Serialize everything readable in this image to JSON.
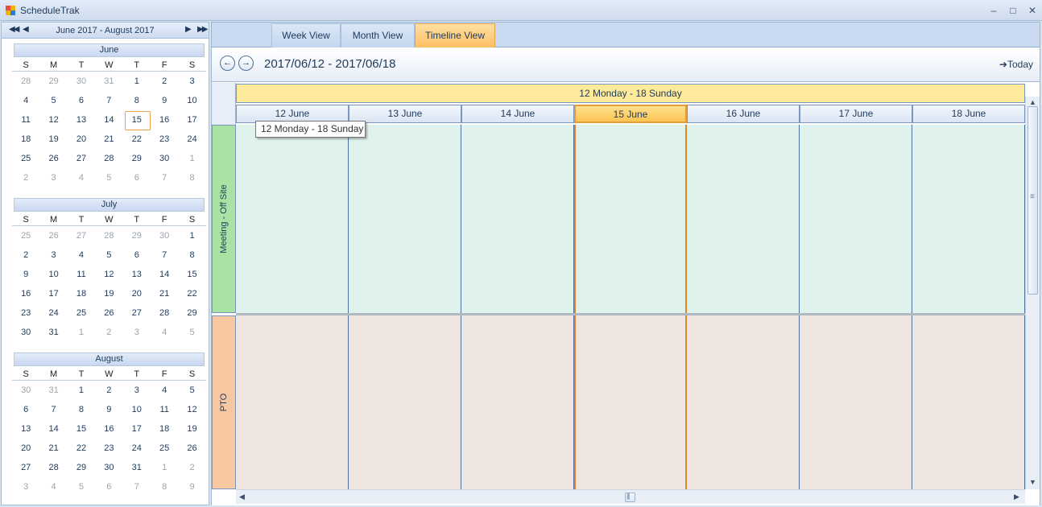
{
  "window": {
    "title": "ScheduleTrak",
    "min": "▭",
    "max": "□",
    "close": "✕"
  },
  "calendar": {
    "nav_prev_month": "◀◀",
    "nav_prev": "◀",
    "nav_next": "▶",
    "nav_next_month": "▶▶",
    "range": "June 2017 - August 2017",
    "dow": [
      "S",
      "M",
      "T",
      "W",
      "T",
      "F",
      "S"
    ],
    "months": [
      {
        "name": "June",
        "weeks": [
          [
            [
              "28",
              1
            ],
            [
              "29",
              1
            ],
            [
              "30",
              1
            ],
            [
              "31",
              1
            ],
            [
              "1",
              0
            ],
            [
              "2",
              0
            ],
            [
              "3",
              0
            ]
          ],
          [
            [
              "4",
              0
            ],
            [
              "5",
              0
            ],
            [
              "6",
              0
            ],
            [
              "7",
              0
            ],
            [
              "8",
              0
            ],
            [
              "9",
              0
            ],
            [
              "10",
              0
            ]
          ],
          [
            [
              "11",
              0
            ],
            [
              "12",
              0
            ],
            [
              "13",
              0
            ],
            [
              "14",
              0
            ],
            [
              "15",
              2
            ],
            [
              "16",
              0
            ],
            [
              "17",
              0
            ]
          ],
          [
            [
              "18",
              0
            ],
            [
              "19",
              0
            ],
            [
              "20",
              0
            ],
            [
              "21",
              0
            ],
            [
              "22",
              0
            ],
            [
              "23",
              0
            ],
            [
              "24",
              0
            ]
          ],
          [
            [
              "25",
              0
            ],
            [
              "26",
              0
            ],
            [
              "27",
              0
            ],
            [
              "28",
              0
            ],
            [
              "29",
              0
            ],
            [
              "30",
              0
            ],
            [
              "1",
              1
            ]
          ],
          [
            [
              "2",
              1
            ],
            [
              "3",
              1
            ],
            [
              "4",
              1
            ],
            [
              "5",
              1
            ],
            [
              "6",
              1
            ],
            [
              "7",
              1
            ],
            [
              "8",
              1
            ]
          ]
        ]
      },
      {
        "name": "July",
        "weeks": [
          [
            [
              "25",
              1
            ],
            [
              "26",
              1
            ],
            [
              "27",
              1
            ],
            [
              "28",
              1
            ],
            [
              "29",
              1
            ],
            [
              "30",
              1
            ],
            [
              "1",
              0
            ]
          ],
          [
            [
              "2",
              0
            ],
            [
              "3",
              0
            ],
            [
              "4",
              0
            ],
            [
              "5",
              0
            ],
            [
              "6",
              0
            ],
            [
              "7",
              0
            ],
            [
              "8",
              0
            ]
          ],
          [
            [
              "9",
              0
            ],
            [
              "10",
              0
            ],
            [
              "11",
              0
            ],
            [
              "12",
              0
            ],
            [
              "13",
              0
            ],
            [
              "14",
              0
            ],
            [
              "15",
              0
            ]
          ],
          [
            [
              "16",
              0
            ],
            [
              "17",
              0
            ],
            [
              "18",
              0
            ],
            [
              "19",
              0
            ],
            [
              "20",
              0
            ],
            [
              "21",
              0
            ],
            [
              "22",
              0
            ]
          ],
          [
            [
              "23",
              0
            ],
            [
              "24",
              0
            ],
            [
              "25",
              0
            ],
            [
              "26",
              0
            ],
            [
              "27",
              0
            ],
            [
              "28",
              0
            ],
            [
              "29",
              0
            ]
          ],
          [
            [
              "30",
              0
            ],
            [
              "31",
              0
            ],
            [
              "1",
              1
            ],
            [
              "2",
              1
            ],
            [
              "3",
              1
            ],
            [
              "4",
              1
            ],
            [
              "5",
              1
            ]
          ]
        ]
      },
      {
        "name": "August",
        "weeks": [
          [
            [
              "30",
              1
            ],
            [
              "31",
              1
            ],
            [
              "1",
              0
            ],
            [
              "2",
              0
            ],
            [
              "3",
              0
            ],
            [
              "4",
              0
            ],
            [
              "5",
              0
            ]
          ],
          [
            [
              "6",
              0
            ],
            [
              "7",
              0
            ],
            [
              "8",
              0
            ],
            [
              "9",
              0
            ],
            [
              "10",
              0
            ],
            [
              "11",
              0
            ],
            [
              "12",
              0
            ]
          ],
          [
            [
              "13",
              0
            ],
            [
              "14",
              0
            ],
            [
              "15",
              0
            ],
            [
              "16",
              0
            ],
            [
              "17",
              0
            ],
            [
              "18",
              0
            ],
            [
              "19",
              0
            ]
          ],
          [
            [
              "20",
              0
            ],
            [
              "21",
              0
            ],
            [
              "22",
              0
            ],
            [
              "23",
              0
            ],
            [
              "24",
              0
            ],
            [
              "25",
              0
            ],
            [
              "26",
              0
            ]
          ],
          [
            [
              "27",
              0
            ],
            [
              "28",
              0
            ],
            [
              "29",
              0
            ],
            [
              "30",
              0
            ],
            [
              "31",
              0
            ],
            [
              "1",
              1
            ],
            [
              "2",
              1
            ]
          ],
          [
            [
              "3",
              1
            ],
            [
              "4",
              1
            ],
            [
              "5",
              1
            ],
            [
              "6",
              1
            ],
            [
              "7",
              1
            ],
            [
              "8",
              1
            ],
            [
              "9",
              1
            ]
          ]
        ]
      }
    ]
  },
  "tabs": {
    "week": "Week View",
    "month": "Month View",
    "timeline": "Timeline View",
    "active": "timeline"
  },
  "datebar": {
    "prev": "←",
    "next": "→",
    "range": "2017/06/12 - 2017/06/18",
    "today": "➔Today"
  },
  "timeline": {
    "range_header": "12 Monday - 18 Sunday",
    "days": [
      "12 June",
      "13 June",
      "14 June",
      "15 June",
      "16 June",
      "17 June",
      "18 June"
    ],
    "current_day_index": 3,
    "resources": [
      {
        "name": "Meeting - Off Site",
        "color": "#a9e3a3",
        "fill": "#dff2eb"
      },
      {
        "name": "PTO",
        "color": "#f6c7a0",
        "fill": "#efe5e1"
      }
    ],
    "tooltip": "12 Monday - 18 Sunday"
  },
  "scroll": {
    "up": "▲",
    "down": "▼",
    "left": "◀",
    "right": "▶",
    "grip": "≡",
    "hgrip": "|||"
  }
}
